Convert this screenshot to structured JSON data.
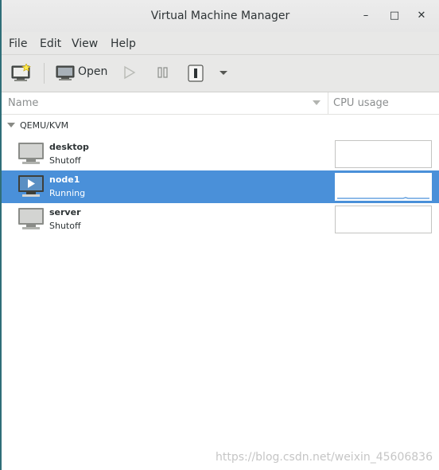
{
  "window": {
    "title": "Virtual Machine Manager"
  },
  "window_controls": {
    "minimize": "–",
    "maximize": "□",
    "close": "✕"
  },
  "menu": {
    "items": [
      "File",
      "Edit",
      "View",
      "Help"
    ]
  },
  "toolbar": {
    "new_vm_icon": "new-vm-icon",
    "open_label": "Open",
    "run_icon": "play-icon",
    "pause_icon": "pause-icon",
    "shutdown_icon": "shutdown-icon",
    "more_icon": "chevron-down-icon"
  },
  "columns": {
    "name": "Name",
    "cpu": "CPU usage"
  },
  "connection": {
    "label": "QEMU/KVM"
  },
  "vms": [
    {
      "name": "desktop",
      "status": "Shutoff",
      "selected": false
    },
    {
      "name": "node1",
      "status": "Running",
      "selected": true
    },
    {
      "name": "server",
      "status": "Shutoff",
      "selected": false
    }
  ],
  "colors": {
    "selection": "#4a90d9",
    "header_bg": "#e8e8e7"
  },
  "watermark": "https://blog.csdn.net/weixin_45606836"
}
